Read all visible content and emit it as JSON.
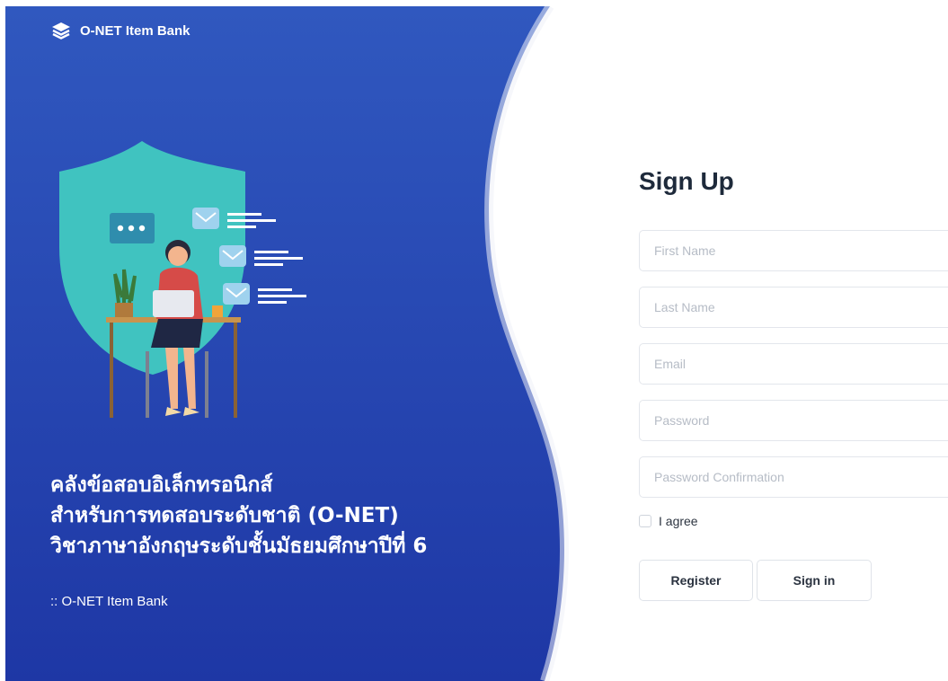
{
  "brand": {
    "name": "O-NET Item Bank",
    "logo_icon": "layers-icon"
  },
  "hero": {
    "headline_lines": [
      "คลังข้อสอบอิเล็กทรอนิกส์",
      "สำหรับการทดสอบระดับชาติ (O-NET)",
      "วิชาภาษาอังกฤษระดับชั้นมัธยมศึกษาปีที่ 6"
    ],
    "tagline": ":: O-NET Item Bank",
    "illustration": "woman-at-laptop-shield-illustration"
  },
  "form": {
    "title": "Sign Up",
    "fields": {
      "first_name": {
        "placeholder": "First Name",
        "value": ""
      },
      "last_name": {
        "placeholder": "Last Name",
        "value": ""
      },
      "email": {
        "placeholder": "Email",
        "value": ""
      },
      "password": {
        "placeholder": "Password",
        "value": ""
      },
      "password_confirmation": {
        "placeholder": "Password Confirmation",
        "value": ""
      }
    },
    "agree_label": "I agree",
    "agree_checked": false,
    "register_label": "Register",
    "signin_label": "Sign in"
  },
  "colors": {
    "hero_top": "#2f57bf",
    "hero_bottom": "#1f38a6",
    "shield": "#3fc3c0",
    "title_text": "#1e2a3b"
  }
}
